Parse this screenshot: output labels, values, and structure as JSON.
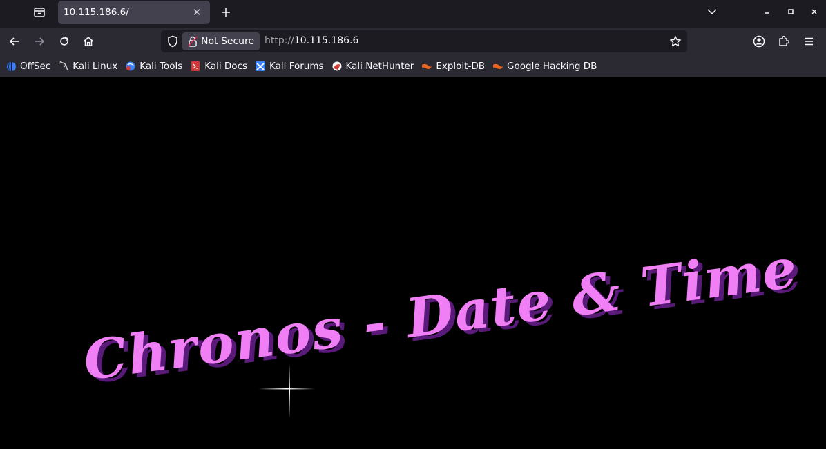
{
  "browser": {
    "tab": {
      "title": "10.115.186.6/"
    },
    "nav": {
      "security_label": "Not Secure",
      "url_scheme": "http://",
      "url_host": "10.115.186.6"
    },
    "bookmarks": [
      {
        "label": "OffSec",
        "icon": "offsec-icon",
        "color": "#3d7ef5"
      },
      {
        "label": "Kali Linux",
        "icon": "kali-dragon-icon",
        "color": "#c8c8c8"
      },
      {
        "label": "Kali Tools",
        "icon": "kali-tools-icon",
        "color": "#3b82f6"
      },
      {
        "label": "Kali Docs",
        "icon": "kali-docs-icon",
        "color": "#d33a3a"
      },
      {
        "label": "Kali Forums",
        "icon": "kali-forums-icon",
        "color": "#3b82f6"
      },
      {
        "label": "Kali NetHunter",
        "icon": "nethunter-icon",
        "color": "#d33a3a"
      },
      {
        "label": "Exploit-DB",
        "icon": "exploit-db-icon",
        "color": "#e8661e"
      },
      {
        "label": "Google Hacking DB",
        "icon": "ghdb-icon",
        "color": "#e8661e"
      }
    ]
  },
  "page": {
    "logo_text": "Chronos - Date & Time",
    "logo_color": "#f07ef5",
    "background": "#000000"
  }
}
